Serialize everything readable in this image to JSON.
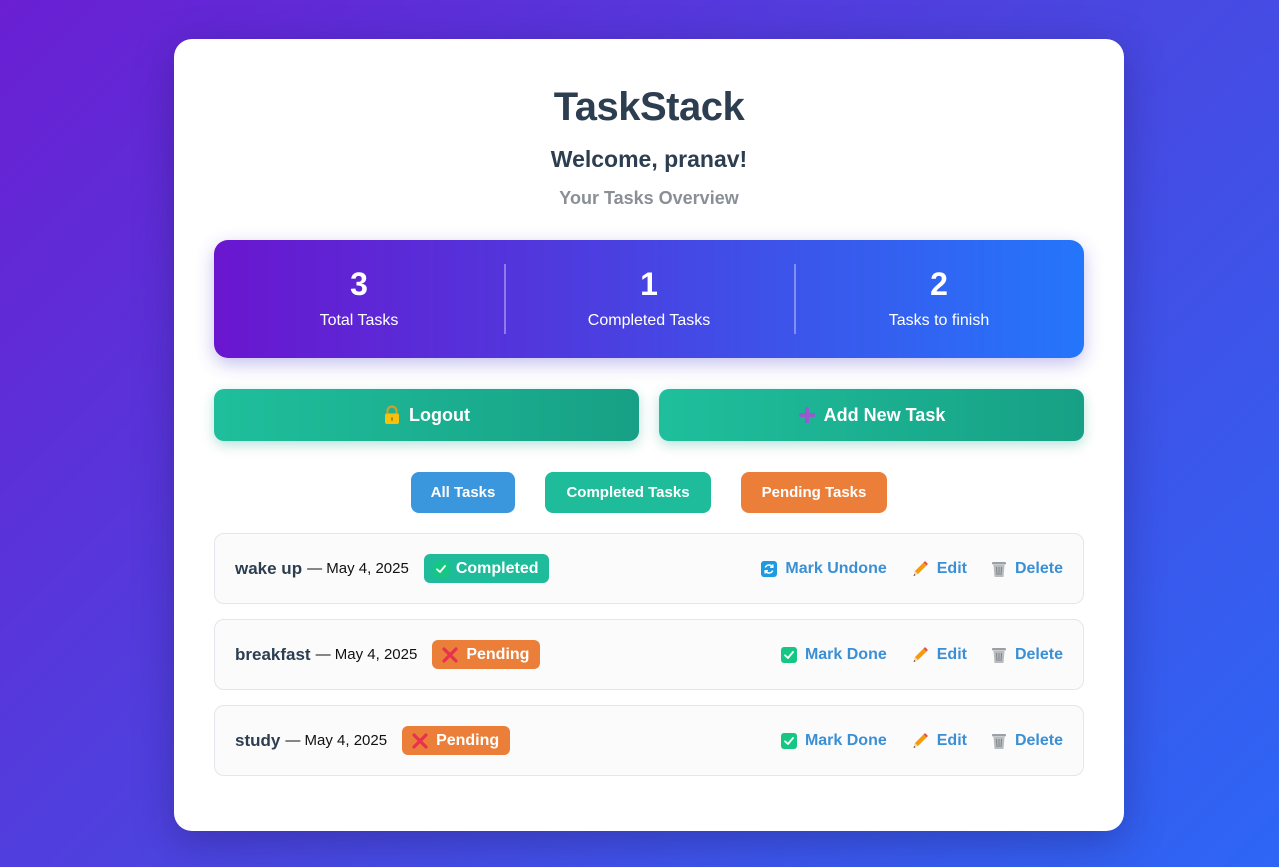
{
  "app": {
    "title": "TaskStack",
    "welcome": "Welcome, pranav!",
    "subtitle": "Your Tasks Overview"
  },
  "stats": [
    {
      "value": "3",
      "label": "Total Tasks"
    },
    {
      "value": "1",
      "label": "Completed Tasks"
    },
    {
      "value": "2",
      "label": "Tasks to finish"
    }
  ],
  "actions": {
    "logout_label": "Logout",
    "logout_icon": "lock-icon",
    "add_label": "Add New Task",
    "add_icon": "plus-icon"
  },
  "filters": [
    {
      "label": "All Tasks",
      "color": "#3b97dd"
    },
    {
      "label": "Completed Tasks",
      "color": "#1fbc9b"
    },
    {
      "label": "Pending Tasks",
      "color": "#eb7f3a"
    }
  ],
  "tasks": [
    {
      "name": "wake up",
      "date": "— May 4, 2025",
      "status": "Completed",
      "toggle_label": "Mark Undone",
      "toggle_icon": "refresh-icon",
      "edit_label": "Edit",
      "delete_label": "Delete"
    },
    {
      "name": "breakfast",
      "date": "— May 4, 2025",
      "status": "Pending",
      "toggle_label": "Mark Done",
      "toggle_icon": "checkbox-icon",
      "edit_label": "Edit",
      "delete_label": "Delete"
    },
    {
      "name": "study",
      "date": "— May 4, 2025",
      "status": "Pending",
      "toggle_label": "Mark Done",
      "toggle_icon": "checkbox-icon",
      "edit_label": "Edit",
      "delete_label": "Delete"
    }
  ],
  "colors": {
    "completed": "#1fbc9b",
    "pending": "#eb7f3a",
    "link": "#3b8fd4"
  }
}
